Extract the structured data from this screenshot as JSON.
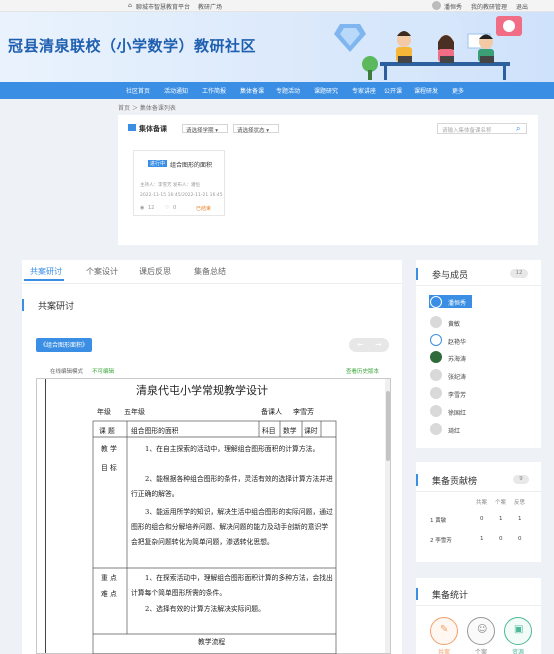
{
  "topbar": {
    "platform": "聊城市智慧教育平台",
    "square": "教研广场",
    "user": "潘恒秀",
    "manage": "我的教研管理",
    "logout": "退出"
  },
  "banner": {
    "title": "冠县清泉联校（小学数学）教研社区"
  },
  "nav": [
    "社区首页",
    "活动通知",
    "工作简报",
    "集体备课",
    "专题活动",
    "课题研究",
    "专家讲座",
    "公开课",
    "课程研发",
    "更多"
  ],
  "breadcrumb": "首页 ＞ 集体备课列表",
  "filters": {
    "label": "集体备课",
    "select1": "请选择学期",
    "select2": "请选择状态",
    "search_placeholder": "请输入集体备课名称"
  },
  "lesson_card": {
    "tag": "进行中",
    "title": "组合图形的面积",
    "people": "主持人：李雪芳    发布人：潘恒",
    "dates": "2022-11-15 16:45/2022-11-21 16:45",
    "views": "12",
    "likes": "0",
    "status": "已结束"
  },
  "tabs": [
    "共案研讨",
    "个案设计",
    "课后反思",
    "集备总结"
  ],
  "section_title": "共案研讨",
  "doc_button": "《组合图形面积》",
  "edit_mode": "在线编辑模式",
  "edit_state": "不可编辑",
  "history": "查看历史版本",
  "doc": {
    "heading": "清泉代屯小学常规教学设计",
    "grade_label": "年级",
    "grade": "五年级",
    "preparer_label": "备课人",
    "preparer": "李雪芳",
    "topic_label": "课  题",
    "topic": "组合图形的面积",
    "subject_label": "科目",
    "subject": "数学",
    "period_label": "课时",
    "goal_label_1": "教  学",
    "goal_label_2": "目  标",
    "goals": [
      "1、在自主探索的活动中，理解组合图形面积的计算方法。",
      "2、能根据各种组合图形的条件，灵活有效的选择计算方法并进行正确的解答。",
      "3、能运用所学的知识，解决生活中组合图形的实际问题，通过图形的组合和分解培养问题、解决问题的能力及动手创新的意识学会把复杂问题转化为简单问题，渗透转化思想。"
    ],
    "key_label_1": "重  点",
    "key_label_2": "难  点",
    "keys": [
      "1、在探索活动中，理解组合图形面积计算的多种方法，会找出计算每个简单图形所需的条件。",
      "2、选择有效的计算方法解决实际问题。"
    ],
    "flow": "教学流程"
  },
  "members": {
    "title": "参与成员",
    "count": "12",
    "list": [
      "潘恒秀",
      "黄敏",
      "赵艳华",
      "苏海涛",
      "张纪涛",
      "李雪芳",
      "徐国红",
      "琦红"
    ]
  },
  "ranking": {
    "title": "集备贡献榜",
    "count": "9",
    "headers": [
      "共案",
      "个案",
      "反思"
    ],
    "rows": [
      {
        "name": "1 黄敏",
        "vals": [
          "0",
          "1",
          "1"
        ]
      },
      {
        "name": "2 李雪芳",
        "vals": [
          "1",
          "0",
          "0"
        ]
      }
    ]
  },
  "stats": {
    "title": "集备统计",
    "items": [
      "共案",
      "个案",
      "资源"
    ]
  }
}
